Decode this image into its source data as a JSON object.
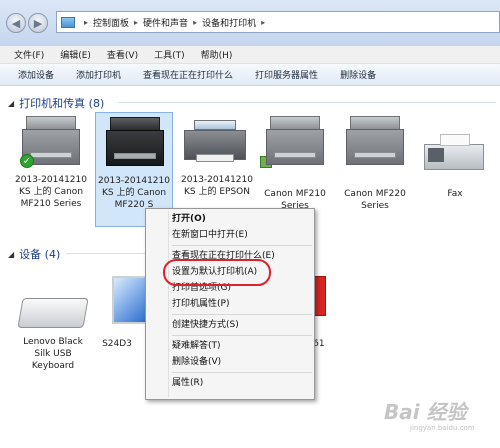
{
  "address": {
    "crumbs": [
      "控制面板",
      "硬件和声音",
      "设备和打印机"
    ]
  },
  "menubar": {
    "items": [
      "文件(F)",
      "编辑(E)",
      "查看(V)",
      "工具(T)",
      "帮助(H)"
    ]
  },
  "toolbar": {
    "items": [
      "添加设备",
      "添加打印机",
      "查看现在正在打印什么",
      "打印服务器属性",
      "删除设备"
    ]
  },
  "printers_group": {
    "title": "打印机和传真 (8)"
  },
  "devices_group": {
    "title": "设备 (4)"
  },
  "printers": [
    {
      "label": "2013-20141210 KS 上的 Canon MF210 Series"
    },
    {
      "label": "2013-20141210 KS 上的 Canon MF220 S"
    },
    {
      "label": "2013-20141210 KS 上的 EPSON"
    },
    {
      "label": "Canon MF210 Series"
    },
    {
      "label": "Canon MF220 Series"
    },
    {
      "label": "Fax"
    }
  ],
  "devices": [
    {
      "label": "Lenovo Black Silk USB Keyboard"
    },
    {
      "label": "S24D3"
    },
    {
      "label": "261"
    }
  ],
  "context_menu": {
    "items": [
      {
        "label": "打开(O)",
        "bold": true
      },
      {
        "label": "在新窗口中打开(E)"
      },
      {
        "label": "查看现在正在打印什么(E)"
      },
      {
        "label": "设置为默认打印机(A)"
      },
      {
        "label": "打印首选项(G)"
      },
      {
        "label": "打印机属性(P)"
      },
      {
        "label": "创建快捷方式(S)"
      },
      {
        "label": "疑难解答(T)"
      },
      {
        "label": "删除设备(V)"
      },
      {
        "label": "属性(R)"
      }
    ]
  },
  "watermark": {
    "text": "Bai 经验",
    "sub": "jingyan.baidu.com"
  },
  "colors": {
    "accent": "#1e3f8a",
    "highlight": "#e0202a",
    "selection": "#d2e6fa"
  }
}
